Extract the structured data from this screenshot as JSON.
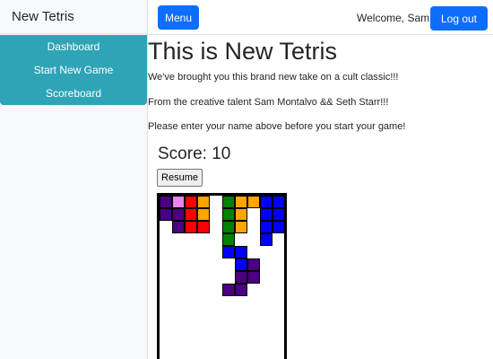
{
  "app": {
    "brand": "New Tetris"
  },
  "sidebar": {
    "items": [
      "Dashboard",
      "Start New Game",
      "Scoreboard"
    ]
  },
  "header": {
    "menu_label": "Menu",
    "welcome": "Welcome, Sam",
    "logout_label": "Log out"
  },
  "main": {
    "title": "This is New Tetris",
    "paragraphs": [
      "We've brought you this brand new take on a cult classic!!!",
      "From the creative talent Sam Montalvo && Seth Starr!!!",
      "Please enter your name above before you start your game!"
    ],
    "score": "Score: 10",
    "resume_label": "Resume"
  },
  "colors": {
    "accent": "#0d6efd",
    "sidebar_menu": "#2fa4b6",
    "purple": "#4b0082",
    "violet": "#ee82ee",
    "red": "#ff0000",
    "orange": "#ffa500",
    "green": "#008000",
    "blue": "#0000ff"
  },
  "board": {
    "columns": 10,
    "cells": [
      {
        "col": 0,
        "row": 0,
        "color": "purple"
      },
      {
        "col": 1,
        "row": 0,
        "color": "violet"
      },
      {
        "col": 2,
        "row": 0,
        "color": "red"
      },
      {
        "col": 3,
        "row": 0,
        "color": "orange"
      },
      {
        "col": 5,
        "row": 0,
        "color": "green"
      },
      {
        "col": 6,
        "row": 0,
        "color": "orange"
      },
      {
        "col": 7,
        "row": 0,
        "color": "orange"
      },
      {
        "col": 8,
        "row": 0,
        "color": "blue"
      },
      {
        "col": 9,
        "row": 0,
        "color": "blue"
      },
      {
        "col": 0,
        "row": 1,
        "color": "purple"
      },
      {
        "col": 1,
        "row": 1,
        "color": "purple"
      },
      {
        "col": 2,
        "row": 1,
        "color": "red"
      },
      {
        "col": 3,
        "row": 1,
        "color": "orange"
      },
      {
        "col": 5,
        "row": 1,
        "color": "green"
      },
      {
        "col": 6,
        "row": 1,
        "color": "orange"
      },
      {
        "col": 8,
        "row": 1,
        "color": "blue"
      },
      {
        "col": 9,
        "row": 1,
        "color": "blue"
      },
      {
        "col": 1,
        "row": 2,
        "color": "purple"
      },
      {
        "col": 2,
        "row": 2,
        "color": "red"
      },
      {
        "col": 3,
        "row": 2,
        "color": "red"
      },
      {
        "col": 5,
        "row": 2,
        "color": "green"
      },
      {
        "col": 6,
        "row": 2,
        "color": "orange"
      },
      {
        "col": 8,
        "row": 2,
        "color": "blue"
      },
      {
        "col": 9,
        "row": 2,
        "color": "blue"
      },
      {
        "col": 5,
        "row": 3,
        "color": "green"
      },
      {
        "col": 8,
        "row": 3,
        "color": "blue"
      },
      {
        "col": 5,
        "row": 4,
        "color": "blue"
      },
      {
        "col": 6,
        "row": 4,
        "color": "blue"
      },
      {
        "col": 6,
        "row": 5,
        "color": "blue"
      },
      {
        "col": 7,
        "row": 5,
        "color": "purple"
      },
      {
        "col": 6,
        "row": 6,
        "color": "purple"
      },
      {
        "col": 7,
        "row": 6,
        "color": "purple"
      },
      {
        "col": 5,
        "row": 7,
        "color": "purple"
      },
      {
        "col": 6,
        "row": 7,
        "color": "purple"
      }
    ]
  }
}
